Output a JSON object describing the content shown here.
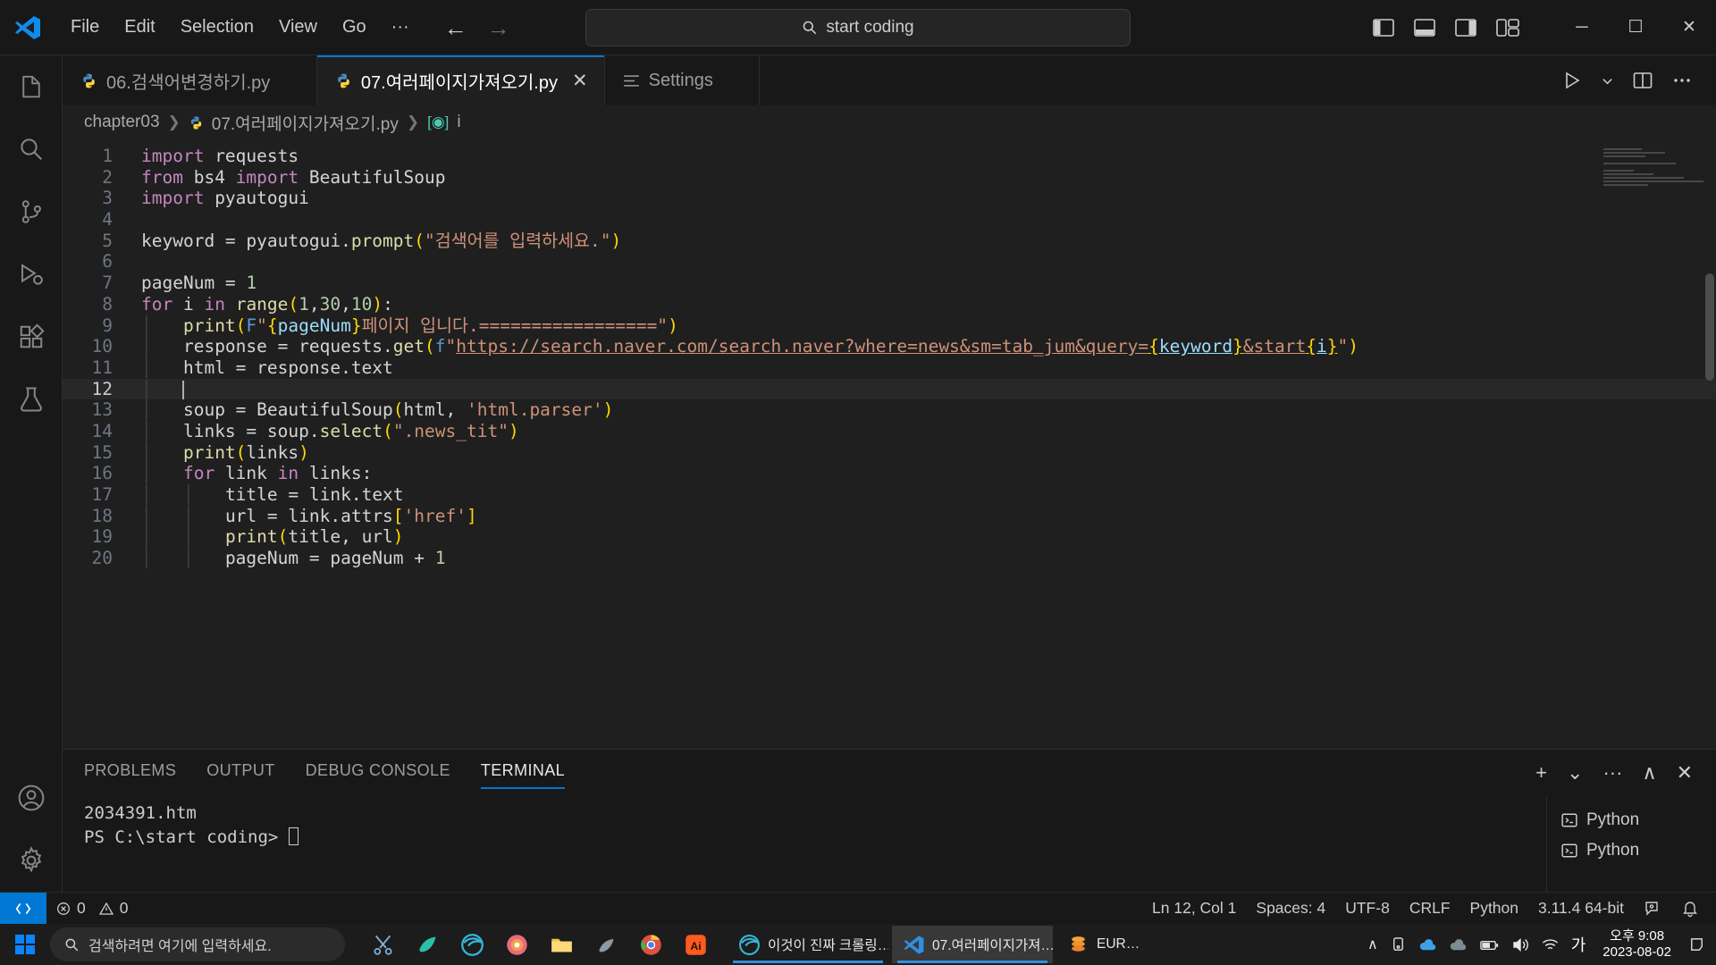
{
  "titlebar": {
    "logo_icon": "vscode-logo-icon",
    "menus": [
      "File",
      "Edit",
      "Selection",
      "View",
      "Go",
      "···"
    ],
    "nav_back_icon": "arrow-left-icon",
    "nav_forward_icon": "arrow-right-icon",
    "command_center": {
      "icon": "search-icon",
      "text": "start coding"
    },
    "layout_icons": [
      "toggle-primary-sidebar-icon",
      "toggle-panel-icon",
      "toggle-secondary-sidebar-icon",
      "customize-layout-icon"
    ],
    "window_controls": {
      "minimize": "─",
      "maximize": "☐",
      "close": "✕"
    }
  },
  "activitybar": {
    "items": [
      {
        "name": "explorer",
        "icon": "files-icon",
        "active": false
      },
      {
        "name": "search",
        "icon": "search-icon",
        "active": false
      },
      {
        "name": "source-control",
        "icon": "source-control-icon",
        "active": false
      },
      {
        "name": "run-and-debug",
        "icon": "run-debug-icon",
        "active": false
      },
      {
        "name": "extensions",
        "icon": "extensions-icon",
        "active": false
      },
      {
        "name": "testing",
        "icon": "beaker-icon",
        "active": false
      }
    ],
    "bottom": [
      {
        "name": "accounts",
        "icon": "account-icon"
      },
      {
        "name": "manage",
        "icon": "gear-icon"
      }
    ]
  },
  "tabs": [
    {
      "label": "06.검색어변경하기.py",
      "icon": "python-file-icon",
      "active": false,
      "close": "✕"
    },
    {
      "label": "07.여러페이지가져오기.py",
      "icon": "python-file-icon",
      "active": true,
      "close": "✕"
    },
    {
      "label": "Settings",
      "icon": "settings-tab-icon",
      "active": false,
      "close": "✕"
    }
  ],
  "tab_actions": {
    "run_icon": "run-play-icon",
    "run_chevron": "chevron-down-icon",
    "split_icon": "split-editor-icon",
    "more_icon": "more-actions-icon"
  },
  "breadcrumb": {
    "folder": "chapter03",
    "sep": "❯",
    "file": "07.여러페이지가져오기.py",
    "symbol_icon": "variable-symbol-icon",
    "symbol": "i"
  },
  "editor": {
    "active_line": 12,
    "lines": [
      {
        "n": 1,
        "tokens": [
          {
            "t": "import",
            "c": "kw"
          },
          {
            "t": " requests",
            "c": "plain"
          }
        ]
      },
      {
        "n": 2,
        "tokens": [
          {
            "t": "from",
            "c": "kw"
          },
          {
            "t": " bs4 ",
            "c": "plain"
          },
          {
            "t": "import",
            "c": "kw"
          },
          {
            "t": " BeautifulSoup",
            "c": "plain"
          }
        ]
      },
      {
        "n": 3,
        "tokens": [
          {
            "t": "import",
            "c": "kw"
          },
          {
            "t": " pyautogui",
            "c": "plain"
          }
        ]
      },
      {
        "n": 4,
        "tokens": []
      },
      {
        "n": 5,
        "tokens": [
          {
            "t": "keyword ",
            "c": "plain"
          },
          {
            "t": "=",
            "c": "op"
          },
          {
            "t": " pyautogui.",
            "c": "plain"
          },
          {
            "t": "prompt",
            "c": "fn"
          },
          {
            "t": "(",
            "c": "punc"
          },
          {
            "t": "\"검색어를 입력하세요.\"",
            "c": "str"
          },
          {
            "t": ")",
            "c": "punc"
          }
        ]
      },
      {
        "n": 6,
        "tokens": []
      },
      {
        "n": 7,
        "tokens": [
          {
            "t": "pageNum ",
            "c": "plain"
          },
          {
            "t": "=",
            "c": "op"
          },
          {
            "t": " ",
            "c": "plain"
          },
          {
            "t": "1",
            "c": "num"
          }
        ]
      },
      {
        "n": 8,
        "tokens": [
          {
            "t": "for",
            "c": "kw"
          },
          {
            "t": " i ",
            "c": "plain"
          },
          {
            "t": "in",
            "c": "kw"
          },
          {
            "t": " ",
            "c": "plain"
          },
          {
            "t": "range",
            "c": "fn"
          },
          {
            "t": "(",
            "c": "punc"
          },
          {
            "t": "1",
            "c": "num"
          },
          {
            "t": ",",
            "c": "plain"
          },
          {
            "t": "30",
            "c": "num"
          },
          {
            "t": ",",
            "c": "plain"
          },
          {
            "t": "10",
            "c": "num"
          },
          {
            "t": ")",
            "c": "punc"
          },
          {
            "t": ":",
            "c": "plain"
          }
        ]
      },
      {
        "n": 9,
        "indent": 1,
        "tokens": [
          {
            "t": "print",
            "c": "fn"
          },
          {
            "t": "(",
            "c": "punc"
          },
          {
            "t": "F",
            "c": "kw2"
          },
          {
            "t": "\"",
            "c": "str"
          },
          {
            "t": "{",
            "c": "punc"
          },
          {
            "t": "pageNum",
            "c": "var"
          },
          {
            "t": "}",
            "c": "punc"
          },
          {
            "t": "페이지 입니다.=================\"",
            "c": "str"
          },
          {
            "t": ")",
            "c": "punc"
          }
        ]
      },
      {
        "n": 10,
        "indent": 1,
        "tokens": [
          {
            "t": "response ",
            "c": "plain"
          },
          {
            "t": "=",
            "c": "op"
          },
          {
            "t": " requests.",
            "c": "plain"
          },
          {
            "t": "get",
            "c": "fn"
          },
          {
            "t": "(",
            "c": "punc"
          },
          {
            "t": "f",
            "c": "kw2"
          },
          {
            "t": "\"",
            "c": "str"
          },
          {
            "t": "https://search.naver.com/search.naver?where=news&sm=tab_jum&query=",
            "c": "str link"
          },
          {
            "t": "{",
            "c": "punc link"
          },
          {
            "t": "keyword",
            "c": "var link"
          },
          {
            "t": "}",
            "c": "punc link"
          },
          {
            "t": "&start",
            "c": "str link"
          },
          {
            "t": "{",
            "c": "punc link"
          },
          {
            "t": "i",
            "c": "var link"
          },
          {
            "t": "}",
            "c": "punc link"
          },
          {
            "t": "\"",
            "c": "str"
          },
          {
            "t": ")",
            "c": "punc"
          }
        ]
      },
      {
        "n": 11,
        "indent": 1,
        "tokens": [
          {
            "t": "html ",
            "c": "plain"
          },
          {
            "t": "=",
            "c": "op"
          },
          {
            "t": " response.text",
            "c": "plain"
          }
        ]
      },
      {
        "n": 12,
        "indent": 1,
        "tokens": [],
        "cursor": true
      },
      {
        "n": 13,
        "indent": 1,
        "tokens": [
          {
            "t": "soup ",
            "c": "plain"
          },
          {
            "t": "=",
            "c": "op"
          },
          {
            "t": " ",
            "c": "plain"
          },
          {
            "t": "BeautifulSoup",
            "c": "plain"
          },
          {
            "t": "(",
            "c": "punc"
          },
          {
            "t": "html, ",
            "c": "plain"
          },
          {
            "t": "'html.parser'",
            "c": "str"
          },
          {
            "t": ")",
            "c": "punc"
          }
        ]
      },
      {
        "n": 14,
        "indent": 1,
        "tokens": [
          {
            "t": "links ",
            "c": "plain"
          },
          {
            "t": "=",
            "c": "op"
          },
          {
            "t": " soup.",
            "c": "plain"
          },
          {
            "t": "select",
            "c": "fn"
          },
          {
            "t": "(",
            "c": "punc"
          },
          {
            "t": "\".news_tit\"",
            "c": "str"
          },
          {
            "t": ")",
            "c": "punc"
          }
        ]
      },
      {
        "n": 15,
        "indent": 1,
        "tokens": [
          {
            "t": "print",
            "c": "fn"
          },
          {
            "t": "(",
            "c": "punc"
          },
          {
            "t": "links",
            "c": "plain"
          },
          {
            "t": ")",
            "c": "punc"
          }
        ]
      },
      {
        "n": 16,
        "indent": 1,
        "tokens": [
          {
            "t": "for",
            "c": "kw"
          },
          {
            "t": " link ",
            "c": "plain"
          },
          {
            "t": "in",
            "c": "kw"
          },
          {
            "t": " links:",
            "c": "plain"
          }
        ]
      },
      {
        "n": 17,
        "indent": 2,
        "tokens": [
          {
            "t": "title ",
            "c": "plain"
          },
          {
            "t": "=",
            "c": "op"
          },
          {
            "t": " link.text",
            "c": "plain"
          }
        ]
      },
      {
        "n": 18,
        "indent": 2,
        "tokens": [
          {
            "t": "url ",
            "c": "plain"
          },
          {
            "t": "=",
            "c": "op"
          },
          {
            "t": " link.attrs",
            "c": "plain"
          },
          {
            "t": "[",
            "c": "punc"
          },
          {
            "t": "'href'",
            "c": "str"
          },
          {
            "t": "]",
            "c": "punc"
          }
        ]
      },
      {
        "n": 19,
        "indent": 2,
        "tokens": [
          {
            "t": "print",
            "c": "fn"
          },
          {
            "t": "(",
            "c": "punc"
          },
          {
            "t": "title, url",
            "c": "plain"
          },
          {
            "t": ")",
            "c": "punc"
          }
        ]
      },
      {
        "n": 20,
        "indent": 2,
        "tokens": [
          {
            "t": "pageNum ",
            "c": "plain"
          },
          {
            "t": "=",
            "c": "op"
          },
          {
            "t": " pageNum ",
            "c": "plain"
          },
          {
            "t": "+",
            "c": "op"
          },
          {
            "t": " ",
            "c": "plain"
          },
          {
            "t": "1",
            "c": "num"
          }
        ]
      }
    ]
  },
  "panel": {
    "tabs": [
      "PROBLEMS",
      "OUTPUT",
      "DEBUG CONSOLE",
      "TERMINAL"
    ],
    "active_tab": "TERMINAL",
    "actions": {
      "new_terminal": "+",
      "chevron": "⌄",
      "more": "···",
      "maximize": "∧",
      "close": "✕"
    },
    "terminal_lines": [
      "2034391.htm",
      "PS C:\\start coding> "
    ],
    "terminal_instances": [
      {
        "label": "Python",
        "icon": "terminal-python-icon"
      },
      {
        "label": "Python",
        "icon": "terminal-python-icon"
      }
    ]
  },
  "statusbar": {
    "remote_icon": "remote-window-icon",
    "errors": "0",
    "warnings": "0",
    "error_icon": "error-circle-icon",
    "warning_icon": "warning-triangle-icon",
    "position": "Ln 12, Col 1",
    "indentation": "Spaces: 4",
    "encoding": "UTF-8",
    "eol": "CRLF",
    "language": "Python",
    "interpreter": "3.11.4 64-bit",
    "feedback_icon": "feedback-icon",
    "bell_icon": "bell-icon"
  },
  "taskbar": {
    "start_icon": "windows-start-icon",
    "search_placeholder": "검색하려면 여기에 입력하세요.",
    "search_icon": "search-icon",
    "pinned": [
      {
        "name": "snip-icon"
      },
      {
        "name": "app-teal-icon"
      },
      {
        "name": "edge-icon"
      },
      {
        "name": "circle-colors-icon"
      },
      {
        "name": "file-explorer-icon"
      },
      {
        "name": "app-gray-icon"
      },
      {
        "name": "chrome-icon"
      },
      {
        "name": "illustrator-icon",
        "label": "Ai"
      }
    ],
    "windows": [
      {
        "label": "이것이 진짜 크롤링…",
        "icon": "edge-icon",
        "active": false
      },
      {
        "label": "07.여러페이지가져…",
        "icon": "vscode-logo-icon",
        "active": true
      },
      {
        "label": "EUR…",
        "icon": "coins-icon",
        "active": false
      }
    ],
    "tray": {
      "chevron": "∧",
      "icons": [
        "monitor-icon",
        "onedrive-icon",
        "cloud-icon",
        "battery-icon",
        "volume-icon",
        "wifi-icon"
      ],
      "ime": "가",
      "time": "오후 9:08",
      "date": "2023-08-02",
      "notification_icon": "notification-bell-icon"
    }
  }
}
